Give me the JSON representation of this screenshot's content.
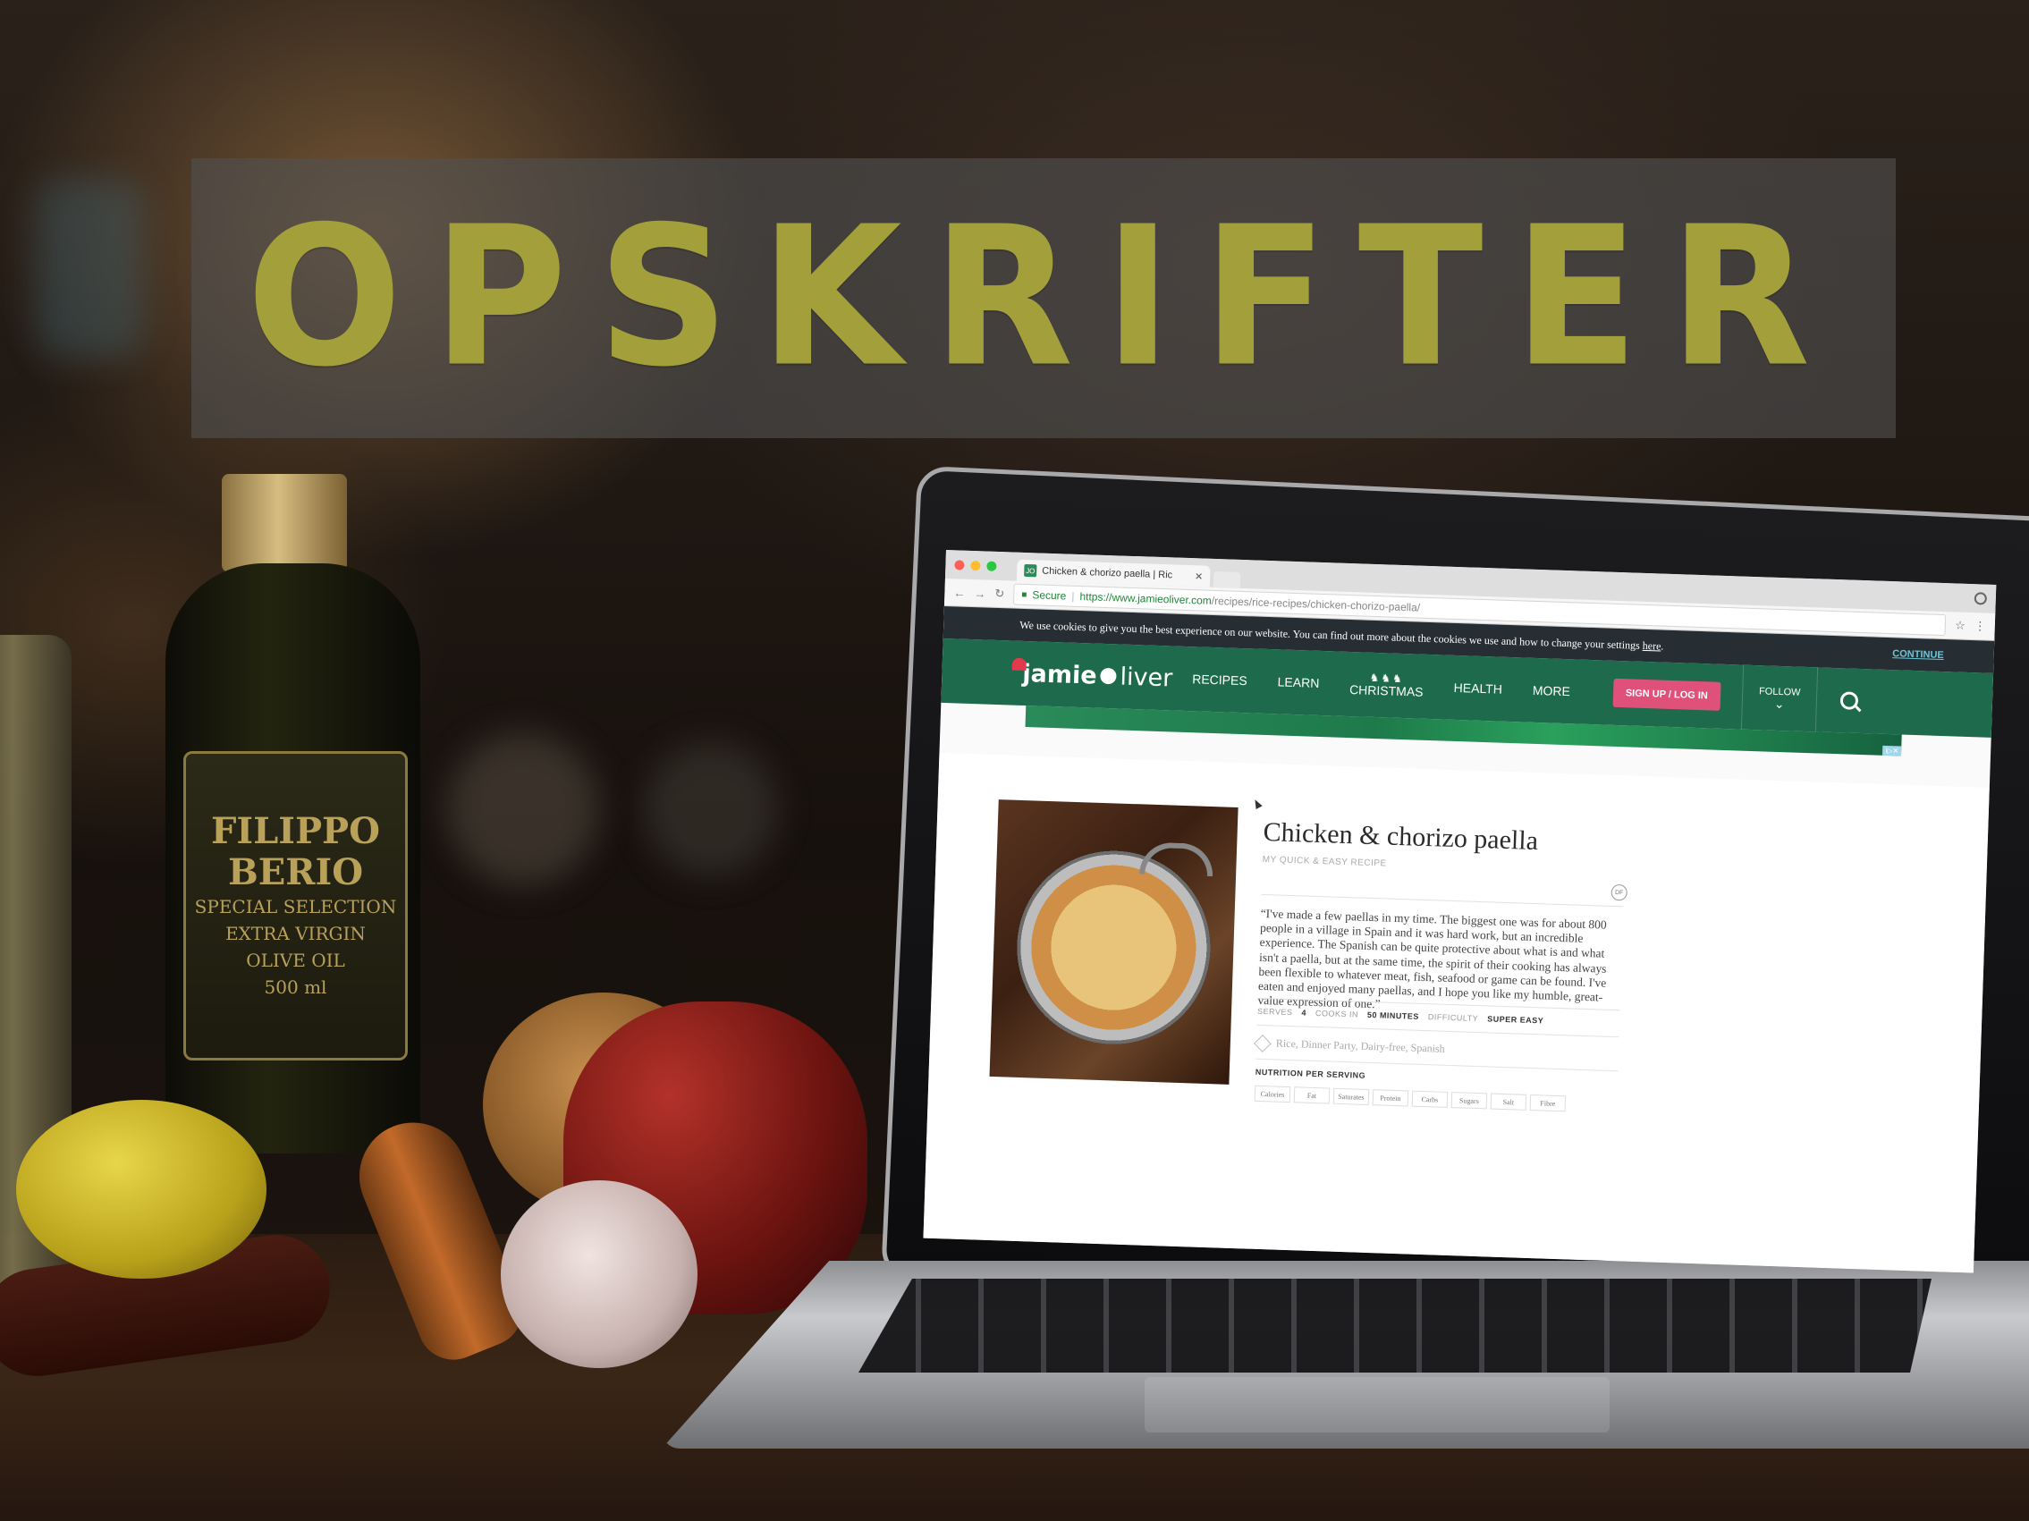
{
  "banner": {
    "title": "OPSKRIFTER"
  },
  "bottle_label": {
    "brand_line1": "FILIPPO",
    "brand_line2": "BERIO",
    "line3": "SPECIAL SELECTION",
    "line4": "EXTRA VIRGIN",
    "line5": "OLIVE OIL",
    "volume": "500 ml"
  },
  "browser": {
    "tab_title": "Chicken & chorizo paella | Ric",
    "tab_favicon_text": "JO",
    "secure_label": "Secure",
    "url_base": "https://www.jamieoliver.com",
    "url_path": "/recipes/rice-recipes/chicken-chorizo-paella/"
  },
  "cookie_bar": {
    "message": "We use cookies to give you the best experience on our website. You can find out more about the cookies we use and how to change your settings",
    "link": "here",
    "continue": "CONTINUE"
  },
  "site_nav": {
    "logo_first": "jamie",
    "logo_second": "liver",
    "items": [
      "RECIPES",
      "LEARN",
      "CHRISTMAS",
      "HEALTH",
      "MORE"
    ],
    "signup": "SIGN UP / LOG IN",
    "follow": "FOLLOW",
    "ad_badge": "i▷✕"
  },
  "recipe": {
    "title": "Chicken & chorizo paella",
    "subtitle": "MY QUICK & EASY RECIPE",
    "badge": "DF",
    "quote": "“I've made a few paellas in my time. The biggest one was for about 800 people in a village in Spain and it was hard work, but an incredible experience. The Spanish can be quite protective about what is and what isn't a paella, but at the same time, the spirit of their cooking has always been flexible to whatever meat, fish, seafood or game can be found. I've eaten and enjoyed many paellas, and I hope you like my humble, great-value expression of one.”",
    "serves_label": "SERVES",
    "serves_value": "4",
    "cooks_label": "COOKS IN",
    "cooks_value": "50 MINUTES",
    "difficulty_label": "DIFFICULTY",
    "difficulty_value": "SUPER EASY",
    "tags": "Rice, Dinner Party, Dairy-free, Spanish",
    "nutrition_title": "NUTRITION PER SERVING",
    "nutrition": [
      "Calories",
      "Fat",
      "Saturates",
      "Protein",
      "Carbs",
      "Sugars",
      "Salt",
      "Fibre"
    ]
  },
  "colors": {
    "title": "#a3a03c",
    "nav_green": "#1e6a4c",
    "signup_pink": "#e0517a",
    "cookie_bar": "#262d33"
  },
  "icons": [
    "search-icon",
    "lock-icon",
    "star-icon",
    "menu-icon",
    "chevron-down-icon",
    "tag-icon",
    "reindeer-icon",
    "santa-hat-icon",
    "ornament-icon",
    "cursor-icon"
  ]
}
